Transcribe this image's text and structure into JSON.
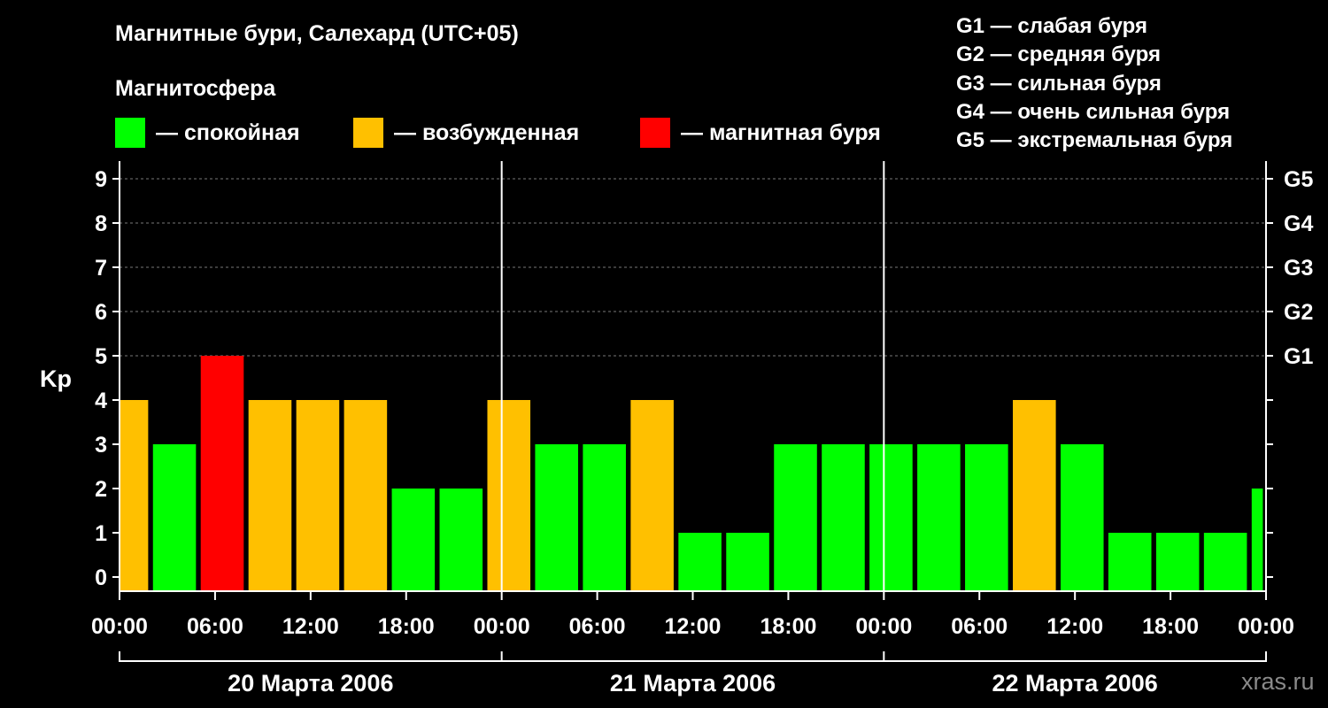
{
  "header": {
    "title": "Магнитные бури, Салехард (UTC+05)",
    "subtitle": "Магнитосфера"
  },
  "legend": [
    {
      "label": "— спокойная",
      "color": "#00ff00"
    },
    {
      "label": "— возбужденная",
      "color": "#ffc000"
    },
    {
      "label": "— магнитная буря",
      "color": "#ff0000"
    }
  ],
  "g_legend": [
    "G1 — слабая буря",
    "G2 — средняя буря",
    "G3 — сильная буря",
    "G4 — очень сильная буря",
    "G5 — экстремальная буря"
  ],
  "watermark": "xras.ru",
  "chart_data": {
    "type": "bar",
    "title": "Магнитные бури, Салехард (UTC+05)",
    "ylabel": "Kp",
    "ylim": [
      0,
      9
    ],
    "yticks": [
      "0",
      "1",
      "2",
      "3",
      "4",
      "5",
      "6",
      "7",
      "8",
      "9"
    ],
    "right_ticks": [
      {
        "value": 5,
        "label": "G1"
      },
      {
        "value": 6,
        "label": "G2"
      },
      {
        "value": 7,
        "label": "G3"
      },
      {
        "value": 8,
        "label": "G4"
      },
      {
        "value": 9,
        "label": "G5"
      }
    ],
    "grid": "dashed horizontal at 5-9",
    "xlim_hours": [
      0,
      72
    ],
    "xticks": [
      "00:00",
      "06:00",
      "12:00",
      "18:00",
      "00:00",
      "06:00",
      "12:00",
      "18:00",
      "00:00",
      "06:00",
      "12:00",
      "18:00",
      "00:00"
    ],
    "days": [
      "20 Марта 2006",
      "21 Марта 2006",
      "22 Марта 2006"
    ],
    "bars": [
      {
        "start": 0,
        "end": 1.8,
        "value": 4,
        "level": "excited"
      },
      {
        "start": 2.1,
        "end": 4.8,
        "value": 3,
        "level": "quiet"
      },
      {
        "start": 5.1,
        "end": 7.8,
        "value": 5,
        "level": "storm"
      },
      {
        "start": 8.1,
        "end": 10.8,
        "value": 4,
        "level": "excited"
      },
      {
        "start": 11.1,
        "end": 13.8,
        "value": 4,
        "level": "excited"
      },
      {
        "start": 14.1,
        "end": 16.8,
        "value": 4,
        "level": "excited"
      },
      {
        "start": 17.1,
        "end": 19.8,
        "value": 2,
        "level": "quiet"
      },
      {
        "start": 20.1,
        "end": 22.8,
        "value": 2,
        "level": "quiet"
      },
      {
        "start": 23.1,
        "end": 25.8,
        "value": 4,
        "level": "excited"
      },
      {
        "start": 26.1,
        "end": 28.8,
        "value": 3,
        "level": "quiet"
      },
      {
        "start": 29.1,
        "end": 31.8,
        "value": 3,
        "level": "quiet"
      },
      {
        "start": 32.1,
        "end": 34.8,
        "value": 4,
        "level": "excited"
      },
      {
        "start": 35.1,
        "end": 37.8,
        "value": 1,
        "level": "quiet"
      },
      {
        "start": 38.1,
        "end": 40.8,
        "value": 1,
        "level": "quiet"
      },
      {
        "start": 41.1,
        "end": 43.8,
        "value": 3,
        "level": "quiet"
      },
      {
        "start": 44.1,
        "end": 46.8,
        "value": 3,
        "level": "quiet"
      },
      {
        "start": 47.1,
        "end": 49.8,
        "value": 3,
        "level": "quiet"
      },
      {
        "start": 50.1,
        "end": 52.8,
        "value": 3,
        "level": "quiet"
      },
      {
        "start": 53.1,
        "end": 55.8,
        "value": 3,
        "level": "quiet"
      },
      {
        "start": 56.1,
        "end": 58.8,
        "value": 4,
        "level": "excited"
      },
      {
        "start": 59.1,
        "end": 61.8,
        "value": 3,
        "level": "quiet"
      },
      {
        "start": 62.1,
        "end": 64.8,
        "value": 1,
        "level": "quiet"
      },
      {
        "start": 65.1,
        "end": 67.8,
        "value": 1,
        "level": "quiet"
      },
      {
        "start": 68.1,
        "end": 70.8,
        "value": 1,
        "level": "quiet"
      },
      {
        "start": 71.1,
        "end": 71.8,
        "value": 2,
        "level": "quiet"
      }
    ],
    "level_colors": {
      "quiet": "#00ff00",
      "excited": "#ffc000",
      "storm": "#ff0000"
    }
  }
}
